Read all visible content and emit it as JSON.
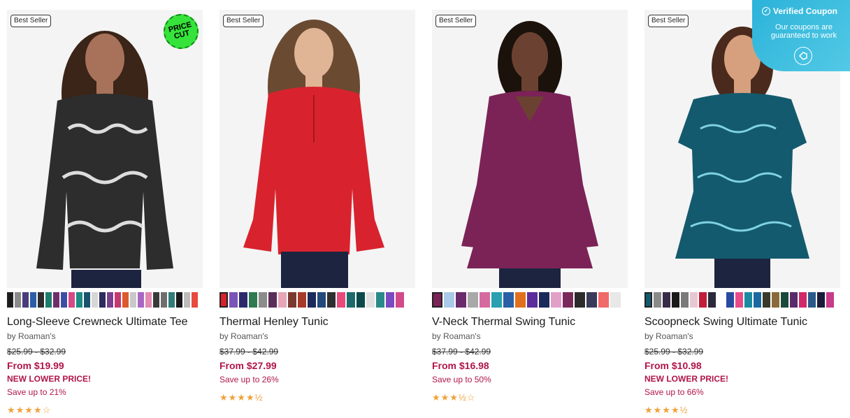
{
  "coupon": {
    "title": "Verified Coupon",
    "subtitle": "Our coupons are guaranteed to work",
    "check_icon": "check-circle-icon",
    "logo_icon": "tag-logo-icon"
  },
  "products": [
    {
      "badge": "Best Seller",
      "price_cut": "PRICE CUT",
      "title": "Long-Sleeve Crewneck Ultimate Tee",
      "brand": "by Roaman's",
      "original_price": "$25.99 - $32.99",
      "from_price": "From $19.99",
      "promo": "NEW LOWER PRICE!",
      "save": "Save up to 21%",
      "rating": 4,
      "stars": "★★★★☆",
      "garment_color": "#2d2d2d",
      "swatches": [
        "#1b1b1b",
        "#8a8a8a",
        "#4a3c7a",
        "#2b5fa6",
        "#2e2e2e",
        "#1e7d6d",
        "#6d2f6b",
        "#3d4fa3",
        "#d34a87",
        "#1d8a86",
        "#18536d",
        "#d7d7d7",
        "#2b2b5c",
        "#7a3f8e",
        "#c23a70",
        "#db5a2e",
        "#c8c8c8",
        "#a868c2",
        "#e48ab4",
        "#3a3a3a",
        "#6e6e6e",
        "#2f7c78",
        "#1a1a1a",
        "#bcbcbc",
        "#e84a3e"
      ]
    },
    {
      "badge": "Best Seller",
      "title": "Thermal Henley Tunic",
      "brand": "by Roaman's",
      "original_price": "$37.99 - $42.99",
      "from_price": "From $27.99",
      "save": "Save up to 26%",
      "rating": 4.5,
      "stars": "★★★★½",
      "garment_color": "#d8232e",
      "swatches": [
        "#d8232e",
        "#7a55b8",
        "#2b2b6b",
        "#2f7a4f",
        "#8c8c8c",
        "#5b2d5a",
        "#e6a6b6",
        "#7b3a2f",
        "#a83a2a",
        "#1a2a5a",
        "#234a7a",
        "#2f2f2f",
        "#e84a7b",
        "#1c6b6b",
        "#0c4a4a",
        "#e0e0e0",
        "#2a8a8a",
        "#7a4ac2",
        "#d24a8a"
      ]
    },
    {
      "badge": "Best Seller",
      "title": "V-Neck Thermal Swing Tunic",
      "brand": "by Roaman's",
      "original_price": "$37.99 - $42.99",
      "from_price": "From $16.98",
      "save": "Save up to 50%",
      "rating": 3.5,
      "stars": "★★★½☆",
      "garment_color": "#7b2357",
      "swatches": [
        "#7b2357",
        "#a9c9e8",
        "#6b2a6b",
        "#a8a8a8",
        "#d56aa0",
        "#2aa0b0",
        "#2b5fa6",
        "#e0701e",
        "#5b2d9b",
        "#1a2a5a",
        "#e0a0c8",
        "#7a2a5a",
        "#2b2b2b",
        "#3a3a5a",
        "#f06a6a",
        "#e8e8e8"
      ]
    },
    {
      "badge": "Best Seller",
      "title": "Scoopneck Swing Ultimate Tunic",
      "brand": "by Roaman's",
      "original_price": "$25.99 - $32.99",
      "from_price": "From $10.98",
      "promo": "NEW LOWER PRICE!",
      "save": "Save up to 66%",
      "rating": 4.5,
      "stars": "★★★★½",
      "garment_color": "#145a6e",
      "swatches": [
        "#145a6e",
        "#8a8a8a",
        "#3a2a4a",
        "#1a1a1a",
        "#7a7a7a",
        "#e8c8d0",
        "#c0203a",
        "#2a2a3a",
        "#ffffff",
        "#2a4aa0",
        "#e84a8a",
        "#1a8aa0",
        "#1a6aa0",
        "#3a3a2a",
        "#8a6a3a",
        "#1a4a3a",
        "#5a2a6a",
        "#d02a6a",
        "#2a5a8a",
        "#1a1a3a",
        "#c83a8a"
      ]
    }
  ]
}
